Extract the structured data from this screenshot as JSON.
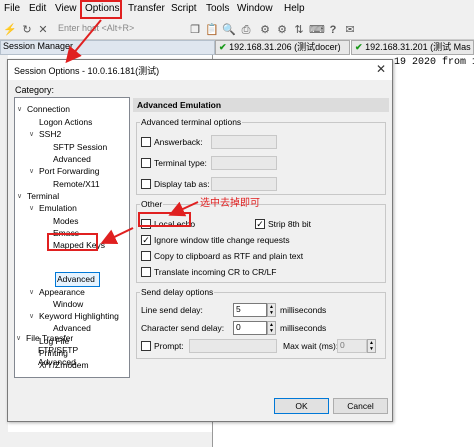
{
  "menubar": {
    "items": [
      "File",
      "Edit",
      "View",
      "Options",
      "Transfer",
      "Script",
      "Tools",
      "Window",
      "Help"
    ]
  },
  "toolbar": {
    "quick_connect_placeholder": "Enter host <Alt+R>"
  },
  "session_manager": {
    "title": "Session Manager"
  },
  "tabs": [
    "192.168.31.206 (测试docer)",
    "192.168.31.201 (测试 Mas"
  ],
  "terminal": {
    "visible_text": "19 2020 from 10"
  },
  "dialog": {
    "title": "Session Options - 10.0.16.181(测试)",
    "category_label": "Category:",
    "tree": [
      "Connection",
      "Logon Actions",
      "SSH2",
      "SFTP Session",
      "Advanced",
      "Port Forwarding",
      "Remote/X11",
      "Terminal",
      "Emulation",
      "Modes",
      "Emacs",
      "Mapped Keys",
      "Advanced",
      "Appearance",
      "Window",
      "Keyword Highlighting",
      "Advanced",
      "Log File",
      "Printing",
      "X/Y/Zmodem",
      "File Transfer",
      "FTP/SFTP",
      "Advanced"
    ],
    "panel_title": "Advanced Emulation",
    "adv_group": "Advanced terminal options",
    "answerback": "Answerback:",
    "terminal_type": "Terminal type:",
    "display_tab_as": "Display tab as:",
    "other_group": "Other",
    "local_echo": "Local echo",
    "strip_8th_bit": "Strip 8th bit",
    "ignore_title": "Ignore window title change requests",
    "copy_rtf": "Copy to clipboard as RTF and plain text",
    "translate_cr": "Translate incoming CR to CR/LF",
    "send_delay_group": "Send delay options",
    "line_send_delay": "Line send delay:",
    "line_send_value": "5",
    "char_send_delay": "Character send delay:",
    "char_send_value": "0",
    "milliseconds": "milliseconds",
    "prompt": "Prompt:",
    "max_wait": "Max wait (ms):",
    "max_wait_value": "0",
    "ok": "OK",
    "cancel": "Cancel"
  },
  "annotation": "选中去掉即可",
  "colors": {
    "highlight_red": "#e02020",
    "check_green": "#1a9a1a",
    "selection_blue": "#0078d7"
  }
}
